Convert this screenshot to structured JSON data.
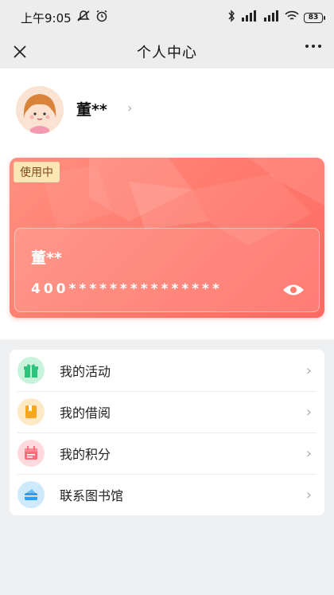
{
  "status_bar": {
    "time": "上午9:05",
    "battery": "83"
  },
  "nav": {
    "title": "个人中心"
  },
  "profile": {
    "name": "董**",
    "arrow": "›"
  },
  "card": {
    "badge": "使用中",
    "holder_name": "董**",
    "number": "400***************"
  },
  "menu": {
    "items": [
      {
        "label": "我的活动",
        "icon": "gift-icon",
        "color": "#2bc27a",
        "bg": "#c9f2dc"
      },
      {
        "label": "我的借阅",
        "icon": "book-icon",
        "color": "#f5a623",
        "bg": "#fde9c4"
      },
      {
        "label": "我的积分",
        "icon": "calendar-icon",
        "color": "#ff6b78",
        "bg": "#ffd9dd"
      },
      {
        "label": "联系图书馆",
        "icon": "library-icon",
        "color": "#2a9df4",
        "bg": "#cde9fb"
      }
    ],
    "arrow": "›"
  }
}
